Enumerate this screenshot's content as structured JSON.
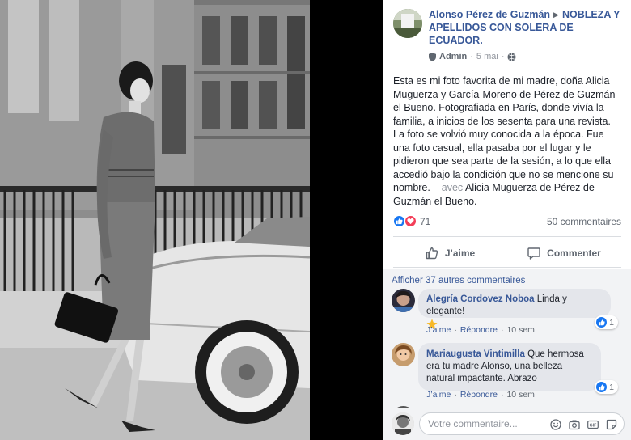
{
  "post": {
    "author": "Alonso Pérez de Guzmán",
    "group": "NOBLEZA Y APELLIDOS CON SOLERA DE ECUADOR.",
    "role": "Admin",
    "date": "5 mai",
    "text": "Esta es mi foto favorita de mi madre, doña Alicia Muguerza y García-Moreno de Pérez de Guzmán el Bueno. Fotografiada en París, donde vivía la familia, a inicios de los sesenta para una revista. La foto se volvió muy conocida a la época. Fue una foto casual, ella pasaba por el lugar y le pidieron que sea parte de la sesión, a lo que ella accedió bajo la condición que no se mencione su nombre.",
    "with_prefix": "– avec",
    "tagged": "Alicia Muguerza de Pérez de Guzmán el Bueno."
  },
  "reactions": {
    "count": "71",
    "comments": "50 commentaires"
  },
  "actions": {
    "like": "J’aime",
    "comment": "Commenter"
  },
  "comments_section": {
    "more": "Afficher 37 autres commentaires",
    "items": [
      {
        "author": "Alegría Cordovez Noboa",
        "text": "Linda y elegante!",
        "like": "J’aime",
        "reply": "Répondre",
        "time": "10 sem",
        "likes": "1"
      },
      {
        "author": "Mariaugusta Vintimilla",
        "text": "Que hermosa era tu madre Alonso, una belleza natural impactante. Abrazo",
        "like": "J’aime",
        "reply": "Répondre",
        "time": "10 sem",
        "likes": "1"
      }
    ]
  },
  "composer": {
    "placeholder": "Votre commentaire..."
  },
  "colors": {
    "link": "#385898",
    "like_blue": "#1877f2",
    "love_red": "#f33e58",
    "panel_bg": "#ffffff",
    "comment_bg": "#f2f3f5"
  },
  "icons": {
    "meta": [
      "shield-icon",
      "globe-icon"
    ],
    "actions": [
      "thumbs-up-icon",
      "comment-icon"
    ],
    "composer_tools": [
      "smiley-icon",
      "camera-icon",
      "gif-icon",
      "sticker-icon"
    ]
  }
}
